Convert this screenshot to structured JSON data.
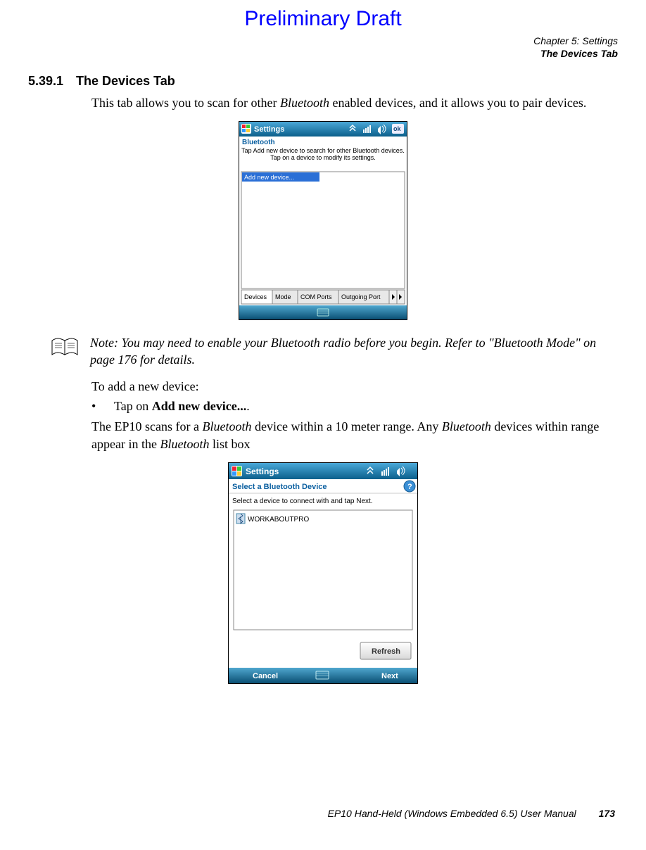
{
  "header": {
    "draft": "Preliminary Draft",
    "chapter_line": "Chapter 5:  Settings",
    "section_line": "The Devices Tab"
  },
  "section": {
    "number": "5.39.1",
    "title": "The Devices Tab"
  },
  "paragraphs": {
    "intro_a": "This tab allows you to scan for other ",
    "intro_b": "Bluetooth",
    "intro_c": " enabled devices, and it allows you to pair devices."
  },
  "screenshot1": {
    "titlebar": "Settings",
    "window_title": "Bluetooth",
    "helptext": "Tap Add new device to search for other Bluetooth devices. Tap on a device to modify its settings.",
    "add_new": "Add new device...",
    "tabs": [
      "Devices",
      "Mode",
      "COM Ports",
      "Outgoing Port"
    ]
  },
  "note": {
    "prefix": "Note: ",
    "body": "You may need to enable your Bluetooth radio before you begin. Refer to \"Bluetooth Mode\" on page 176 for details."
  },
  "add_device": {
    "lead": "To add a new device:",
    "bullet_a": "Tap on ",
    "bullet_b": "Add new device...",
    "bullet_c": ".",
    "after_a": "The EP10 scans for a ",
    "after_b": "Bluetooth",
    "after_c": " device within a 10 meter range. Any ",
    "after_d": "Bluetooth",
    "after_e": " devices within range appear in the ",
    "after_f": "Bluetooth",
    "after_g": " list box"
  },
  "screenshot2": {
    "titlebar": "Settings",
    "window_title": "Select a Bluetooth Device",
    "instruction": "Select a device to connect with and tap Next.",
    "device": "WORKABOUTPRO",
    "refresh": "Refresh",
    "cancel": "Cancel",
    "next": "Next"
  },
  "footer": {
    "book": "EP10 Hand-Held (Windows Embedded 6.5) User Manual",
    "page": "173"
  }
}
